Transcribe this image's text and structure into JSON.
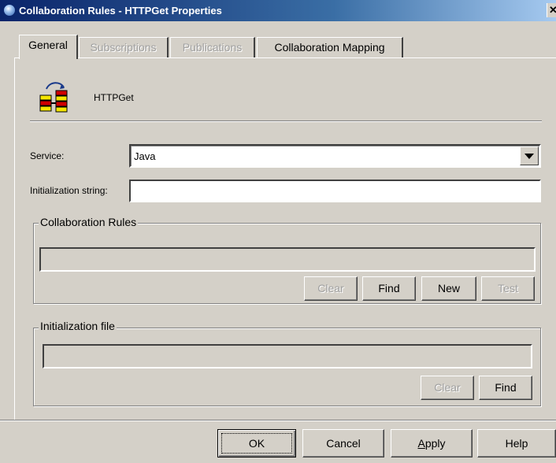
{
  "window": {
    "title": "Collaboration Rules - HTTPGet Properties",
    "close_glyph": "✕"
  },
  "tabs": [
    {
      "label": "General",
      "state": "active"
    },
    {
      "label": "Subscriptions",
      "state": "disabled"
    },
    {
      "label": "Publications",
      "state": "disabled"
    },
    {
      "label": "Collaboration Mapping",
      "state": "enabled"
    }
  ],
  "general": {
    "icon": "collaboration-rules-icon",
    "collaboration_name": "HTTPGet",
    "service": {
      "label": "Service:",
      "value": "Java"
    },
    "init_string": {
      "label": "Initialization string:",
      "value": ""
    },
    "rules_group": {
      "title": "Collaboration Rules",
      "path": "",
      "buttons": {
        "clear": "Clear",
        "find": "Find",
        "new": "New",
        "test": "Test"
      }
    },
    "init_file_group": {
      "title": "Initialization file",
      "path": "",
      "buttons": {
        "clear": "Clear",
        "find": "Find"
      }
    }
  },
  "footer": {
    "ok": "OK",
    "cancel": "Cancel",
    "apply_prefix": "",
    "apply_mnemonic": "A",
    "apply_rest": "pply",
    "help": "Help"
  },
  "colors": {
    "dialog_bg": "#d4d0c8",
    "title_gradient_start": "#0a246a",
    "title_gradient_end": "#a6caf0"
  }
}
